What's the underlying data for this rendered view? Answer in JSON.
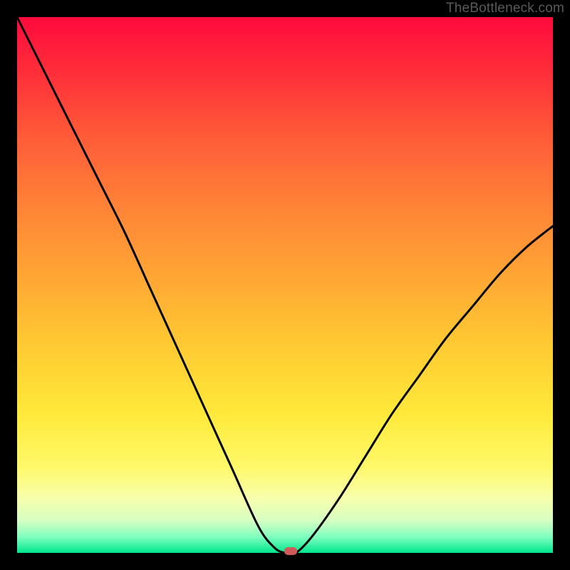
{
  "watermark": "TheBottleneck.com",
  "chart_data": {
    "type": "line",
    "title": "",
    "xlabel": "",
    "ylabel": "",
    "xlim": [
      0,
      100
    ],
    "ylim": [
      0,
      100
    ],
    "grid": false,
    "series": [
      {
        "name": "curve",
        "x": [
          0,
          5,
          10,
          15,
          20,
          25,
          30,
          35,
          40,
          45,
          48,
          50,
          52,
          55,
          60,
          65,
          70,
          75,
          80,
          85,
          90,
          95,
          100
        ],
        "y": [
          100,
          90,
          80,
          70,
          60,
          49,
          38,
          27,
          16,
          5,
          1,
          0,
          0,
          3,
          10,
          18,
          26,
          33,
          40,
          46,
          52,
          57,
          61
        ]
      }
    ],
    "marker": {
      "x": 51,
      "y": 0,
      "color": "#cf5a5a"
    },
    "background_gradient": {
      "direction": "top-to-bottom",
      "stops": [
        {
          "pct": 0,
          "color": "#ff0a3c"
        },
        {
          "pct": 50,
          "color": "#ffb534"
        },
        {
          "pct": 80,
          "color": "#fff050"
        },
        {
          "pct": 100,
          "color": "#00e68c"
        }
      ]
    }
  }
}
